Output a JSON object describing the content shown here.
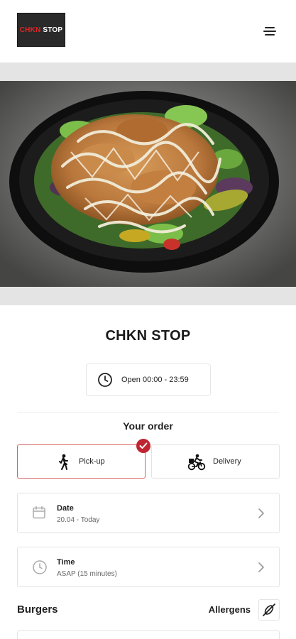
{
  "header": {
    "logo_part1": "CHKN",
    "logo_part2": "STOP",
    "menu_icon": "hamburger-menu-icon"
  },
  "hero": {
    "icon": "salad-bowl-photo"
  },
  "restaurant": {
    "name": "CHKN STOP",
    "hours": "Open 00:00 - 23:59",
    "hours_icon": "clock-icon"
  },
  "order": {
    "label": "Your order",
    "options": [
      {
        "label": "Pick-up",
        "icon": "walking-person-icon",
        "selected": true
      },
      {
        "label": "Delivery",
        "icon": "bicycle-courier-icon",
        "selected": false
      }
    ],
    "date": {
      "label": "Date",
      "value": "20.04 - Today",
      "icon": "calendar-icon"
    },
    "time": {
      "label": "Time",
      "value": "ASAP (15 minutes)",
      "icon": "clock-icon"
    }
  },
  "menu": {
    "section_title": "Burgers",
    "allergens_label": "Allergens",
    "allergens_icon": "no-allergen-icon"
  },
  "colors": {
    "accent": "#bf2430",
    "logo_red": "#e02424",
    "border": "#e3e3e3"
  }
}
